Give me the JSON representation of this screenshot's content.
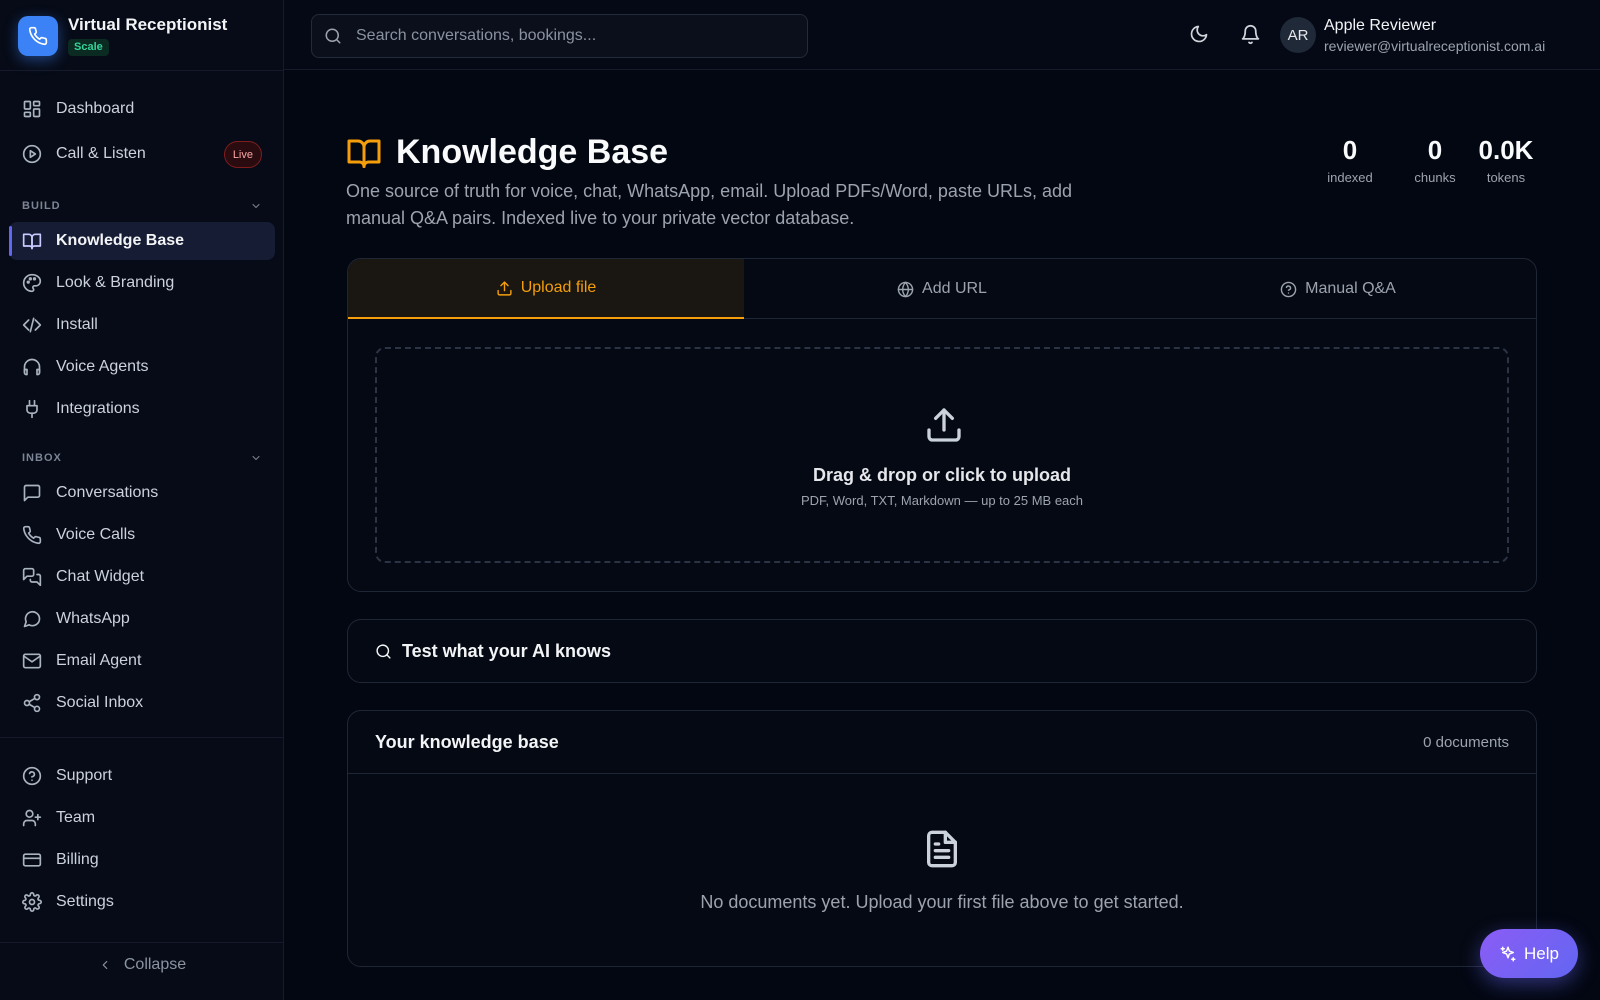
{
  "brand": {
    "name": "Virtual Receptionist",
    "plan": "Scale"
  },
  "nav": {
    "top": [
      {
        "label": "Dashboard",
        "icon": "dashboard-icon"
      },
      {
        "label": "Call & Listen",
        "icon": "play-circle-icon",
        "badge": "Live"
      }
    ],
    "build_label": "BUILD",
    "build": [
      {
        "label": "Knowledge Base",
        "icon": "book-icon",
        "active": true
      },
      {
        "label": "Look & Branding",
        "icon": "palette-icon"
      },
      {
        "label": "Install",
        "icon": "code-icon"
      },
      {
        "label": "Voice Agents",
        "icon": "headphones-icon"
      },
      {
        "label": "Integrations",
        "icon": "plug-icon"
      }
    ],
    "inbox_label": "INBOX",
    "inbox": [
      {
        "label": "Conversations",
        "icon": "message-square-icon"
      },
      {
        "label": "Voice Calls",
        "icon": "phone-icon"
      },
      {
        "label": "Chat Widget",
        "icon": "messages-icon"
      },
      {
        "label": "WhatsApp",
        "icon": "message-circle-icon"
      },
      {
        "label": "Email Agent",
        "icon": "mail-icon"
      },
      {
        "label": "Social Inbox",
        "icon": "share-icon"
      }
    ],
    "bottom": [
      {
        "label": "Support",
        "icon": "help-circle-icon"
      },
      {
        "label": "Team",
        "icon": "user-plus-icon"
      },
      {
        "label": "Billing",
        "icon": "credit-card-icon"
      },
      {
        "label": "Settings",
        "icon": "gear-icon"
      }
    ],
    "collapse_label": "Collapse"
  },
  "topbar": {
    "search_placeholder": "Search conversations, bookings...",
    "user": {
      "initials": "AR",
      "name": "Apple Reviewer",
      "email": "reviewer@virtualreceptionist.com.ai"
    }
  },
  "page": {
    "title": "Knowledge Base",
    "subtitle": "One source of truth for voice, chat, WhatsApp, email. Upload PDFs/Word, paste URLs, add manual Q&A pairs. Indexed live to your private vector database.",
    "stats": [
      {
        "value": "0",
        "label": "indexed"
      },
      {
        "value": "0",
        "label": "chunks"
      },
      {
        "value": "0.0K",
        "label": "tokens"
      }
    ]
  },
  "tabs": [
    {
      "label": "Upload file",
      "icon": "upload-icon",
      "active": true
    },
    {
      "label": "Add URL",
      "icon": "globe-icon"
    },
    {
      "label": "Manual Q&A",
      "icon": "help-circle-icon"
    }
  ],
  "upload": {
    "title": "Drag & drop or click to upload",
    "hint": "PDF, Word, TXT, Markdown — up to 25 MB each"
  },
  "test": {
    "label": "Test what your AI knows"
  },
  "kb": {
    "title": "Your knowledge base",
    "count": "0 documents",
    "empty": "No documents yet. Upload your first file above to get started."
  },
  "help": {
    "label": "Help"
  },
  "colors": {
    "accent": "#f59e0b",
    "brand": "#3b82f6",
    "primary": "#6366f1",
    "live": "#fca5a5"
  }
}
